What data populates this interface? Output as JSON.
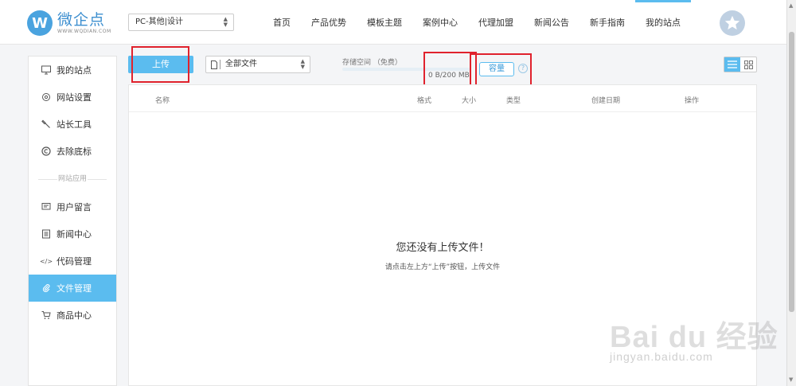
{
  "header": {
    "logo_mark": "W",
    "logo_name": "微企点",
    "logo_domain": "WWW.WQDIAN.COM",
    "site_select": "PC-其他|设计",
    "nav": [
      "首页",
      "产品优势",
      "模板主题",
      "案例中心",
      "代理加盟",
      "新闻公告",
      "新手指南",
      "我的站点"
    ],
    "active_nav": "我的站点"
  },
  "sidebar": {
    "items_top": [
      {
        "label": "我的站点",
        "icon": "monitor-icon"
      },
      {
        "label": "网站设置",
        "icon": "gear-icon"
      },
      {
        "label": "站长工具",
        "icon": "wrench-icon"
      },
      {
        "label": "去除底标",
        "icon": "copyright-icon"
      }
    ],
    "group_label": "网站应用",
    "items_app": [
      {
        "label": "用户留言",
        "icon": "message-icon"
      },
      {
        "label": "新闻中心",
        "icon": "news-icon"
      },
      {
        "label": "代码管理",
        "icon": "code-icon"
      },
      {
        "label": "文件管理",
        "icon": "paperclip-icon"
      },
      {
        "label": "商品中心",
        "icon": "cart-icon"
      }
    ],
    "active": "文件管理"
  },
  "toolbar": {
    "upload_label": "上传",
    "filetype_select": "全部文件",
    "storage_label": "存储空间 （免费）",
    "storage_used": "0 B/200 MB",
    "storage_fraction": 0.0,
    "capacity_label": "容量",
    "help_glyph": "?"
  },
  "table": {
    "columns": [
      "名称",
      "格式",
      "大小",
      "类型",
      "创建日期",
      "操作"
    ]
  },
  "empty": {
    "title": "您还没有上传文件！",
    "subtitle": "请点击左上方“上传”按钮，上传文件"
  },
  "watermark": {
    "brand": "Bai du 经验",
    "url": "jingyan.baidu.com"
  },
  "colors": {
    "accent": "#5bbcef",
    "highlight": "#e0222d",
    "logo": "#4aa3df"
  }
}
